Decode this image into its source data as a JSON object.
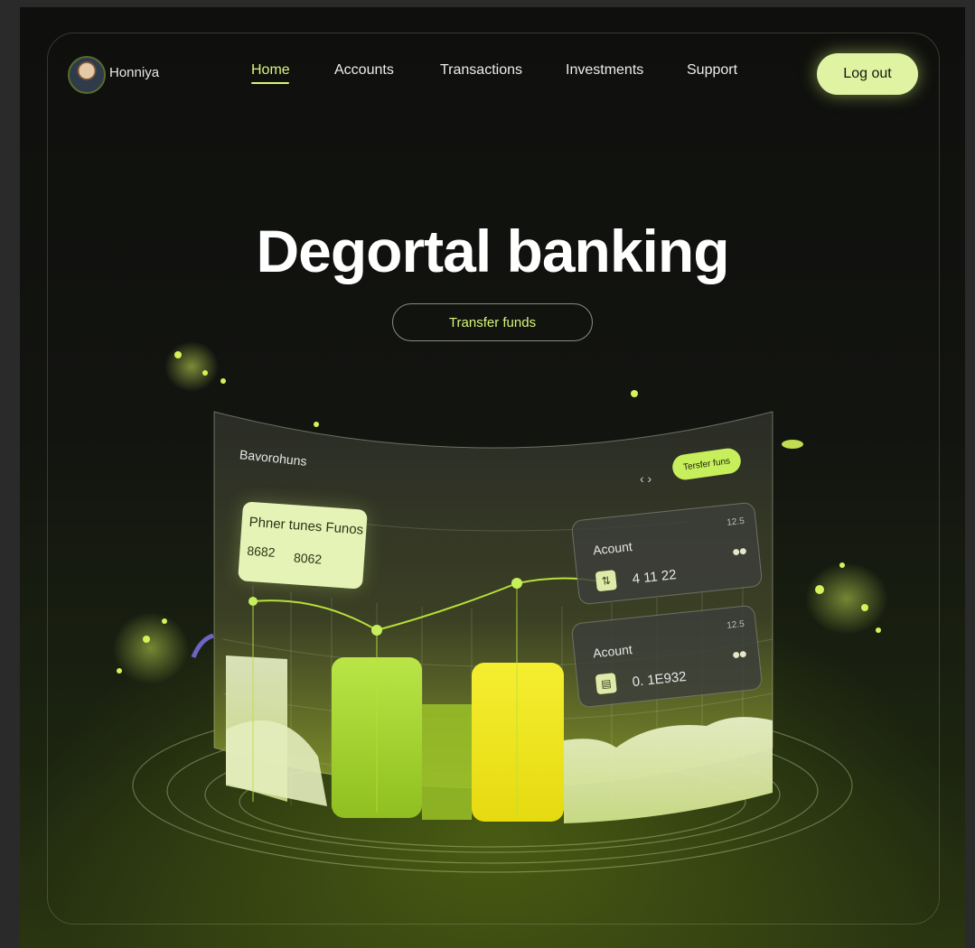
{
  "header": {
    "username": "Honniya",
    "nav": [
      "Home",
      "Accounts",
      "Transactions",
      "Investments",
      "Support"
    ],
    "logout_label": "Log out"
  },
  "hero": {
    "title": "Degortal banking",
    "cta_label": "Transfer funds"
  },
  "dashboard": {
    "title": "Bavorohuns",
    "button_label": "Tersfer funs",
    "nav_glyph": "‹ ›",
    "summary_card": {
      "title": "Phner tunes Funos",
      "value_a": "8682",
      "value_b": "8062"
    },
    "accounts": [
      {
        "label": "Acount",
        "amount": "4 11 22",
        "value": "12.5",
        "icon": "transfer-icon"
      },
      {
        "label": "Acount",
        "amount": "0. 1E932",
        "value": "12.5",
        "icon": "wallet-icon"
      }
    ]
  },
  "colors": {
    "accent": "#d8f57a",
    "button": "#dff3a3",
    "lime": "#b8e03a",
    "yellow": "#f2ea2a"
  }
}
